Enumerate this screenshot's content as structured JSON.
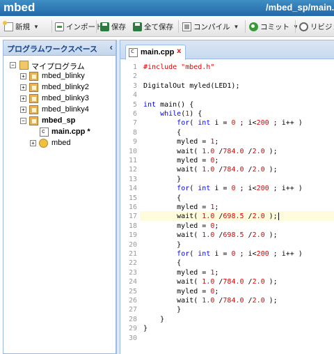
{
  "app": {
    "brand": "mbed",
    "path": "/mbed_sp/main.c"
  },
  "toolbar": {
    "new_label": "新規",
    "import_label": "インポート",
    "save_label": "保存",
    "save_all_label": "全て保存",
    "compile_label": "コンパイル",
    "commit_label": "コミット",
    "revision_label": "リビジョ"
  },
  "left_panel": {
    "title": "プログラムワークスペース",
    "collapse_glyph": "‹",
    "tree": {
      "root": "マイプログラム",
      "programs": [
        "mbed_blinky",
        "mbed_blinky2",
        "mbed_blinky3",
        "mbed_blinky4",
        "mbed_sp"
      ],
      "open_file": "main.cpp *",
      "library": "mbed"
    },
    "toggle_expanded": "−",
    "toggle_collapsed": "+"
  },
  "editor": {
    "tab_label": "main.cpp",
    "tab_close": "x",
    "highlighted_line": 17,
    "lines": [
      "#include \"mbed.h\"",
      "",
      "DigitalOut myled(LED1);",
      "",
      "int main() {",
      "    while(1) {",
      "        for( int i = 0 ; i<200 ; i++ )",
      "        {",
      "        myled = 1;",
      "        wait( 1.0 /784.0 /2.0 );",
      "        myled = 0;",
      "        wait( 1.0 /784.0 /2.0 );",
      "        }",
      "        for( int i = 0 ; i<200 ; i++ )",
      "        {",
      "        myled = 1;",
      "        wait( 1.0 /698.5 /2.0 );",
      "        myled = 0;",
      "        wait( 1.0 /698.5 /2.0 );",
      "        }",
      "        for( int i = 0 ; i<200 ; i++ )",
      "        {",
      "        myled = 1;",
      "        wait( 1.0 /784.0 /2.0 );",
      "        myled = 0;",
      "        wait( 1.0 /784.0 /2.0 );",
      "        }",
      "    }",
      "}",
      ""
    ]
  },
  "colors": {
    "titlebar": "#2268a8",
    "keyword": "#0000ff",
    "number": "#e00000",
    "highlight": "#fffbdd"
  }
}
